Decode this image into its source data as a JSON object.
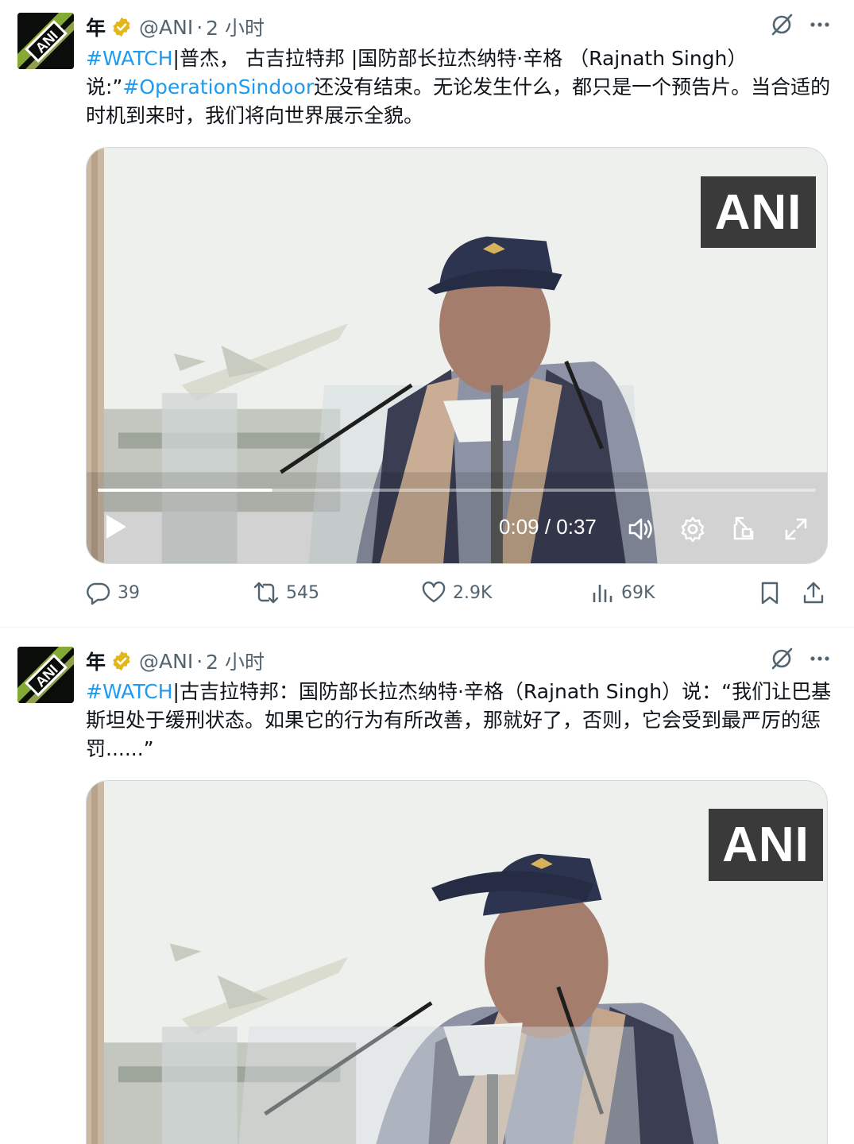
{
  "tweets": [
    {
      "author": {
        "display_name": "年",
        "handle": "@ANI",
        "separator": "·",
        "time": "2 小时"
      },
      "text": {
        "hashtag1": "#WATCH",
        "part1": "|普杰， 古吉拉特邦 |国防部长拉杰纳特·辛格 （Rajnath Singh）说:”",
        "hashtag2": "#OperationSindoor",
        "part2": "还没有结束。无论发生什么，都只是一个预告片。当合适的时机到来时，我们将向世界展示全貌。"
      },
      "video": {
        "badge": "ANI",
        "time_display": "0:09 / 0:37",
        "progress": 0.243
      },
      "actions": {
        "replies": "39",
        "reposts": "545",
        "likes": "2.9K",
        "views": "69K"
      }
    },
    {
      "author": {
        "display_name": "年",
        "handle": "@ANI",
        "separator": "·",
        "time": "2 小时"
      },
      "text": {
        "hashtag1": "#WATCH",
        "part1": "|古吉拉特邦：国防部长拉杰纳特·辛格（Rajnath Singh）说：“我们让巴基斯坦处于缓刑状态。如果它的行为有所改善，那就好了，否则，它会受到最严厉的惩罚......”"
      },
      "video": {
        "badge": "ANI"
      }
    }
  ],
  "colors": {
    "link": "#1d9bf0",
    "muted": "#536471",
    "verified": "#e2b719",
    "badge_bg": "#3a3a3a"
  },
  "icons": {
    "header": [
      "grok-icon",
      "more-icon"
    ],
    "video": [
      "play-icon",
      "volume-icon",
      "settings-icon",
      "pip-icon",
      "fullscreen-icon"
    ],
    "actions": [
      "reply-icon",
      "repost-icon",
      "like-icon",
      "views-icon",
      "bookmark-icon",
      "share-icon"
    ]
  }
}
